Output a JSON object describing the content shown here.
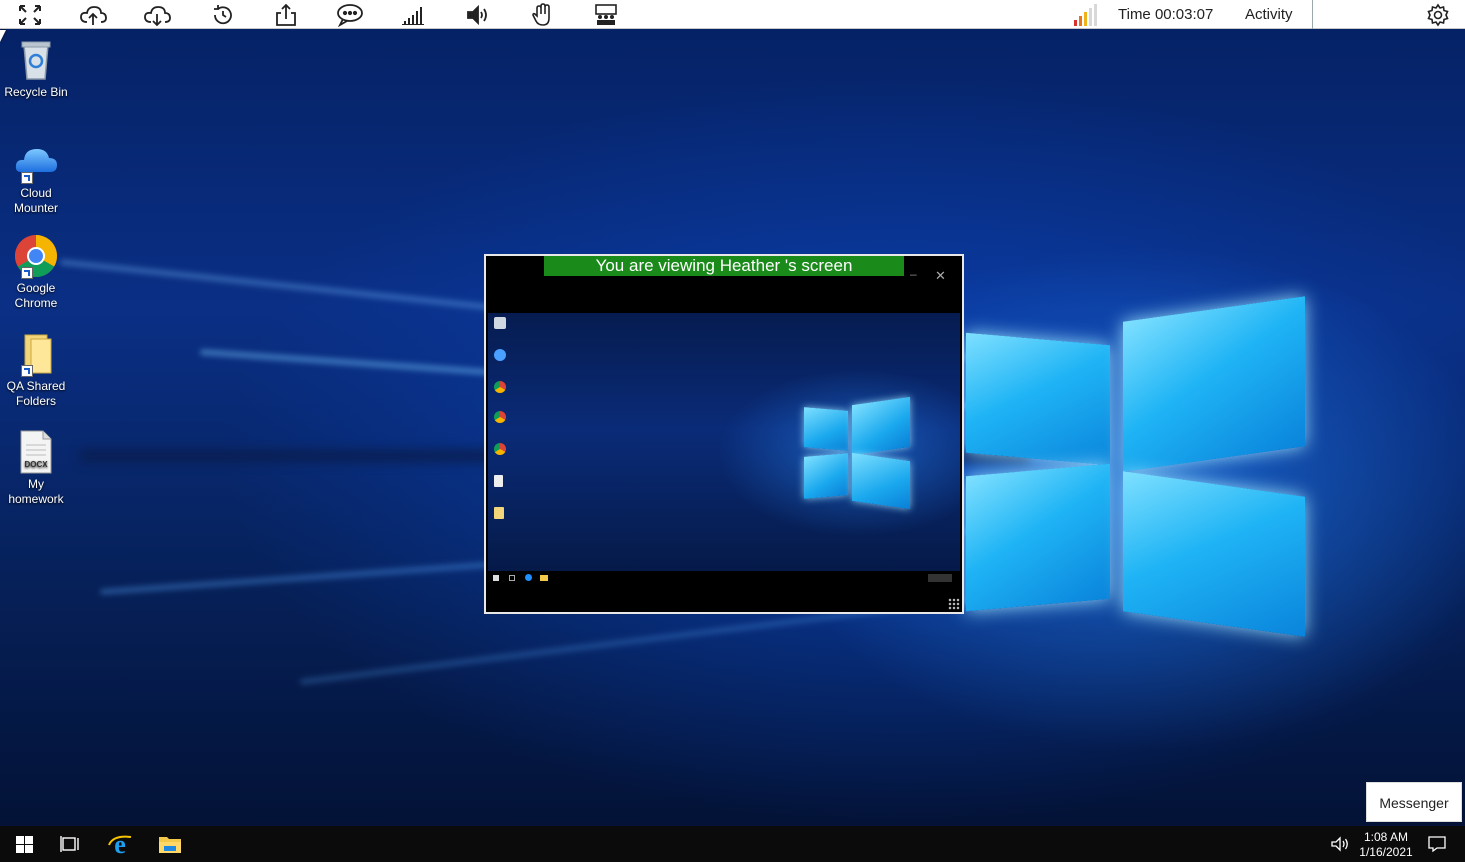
{
  "toolbar": {
    "icons": [
      {
        "name": "fullscreen-icon"
      },
      {
        "name": "cloud-upload-icon"
      },
      {
        "name": "cloud-download-icon"
      },
      {
        "name": "history-icon"
      },
      {
        "name": "share-icon"
      },
      {
        "name": "chat-icon"
      },
      {
        "name": "signal-bars-icon"
      },
      {
        "name": "volume-icon"
      },
      {
        "name": "raise-hand-icon"
      },
      {
        "name": "presenter-icon"
      }
    ],
    "time_label": "Time 00:03:07",
    "activity_label": "Activity",
    "settings_icon": "gear-icon"
  },
  "desktop_icons": [
    {
      "label": "Recycle Bin"
    },
    {
      "label": "Cloud Mounter"
    },
    {
      "label": "Google Chrome"
    },
    {
      "label": "QA Shared Folders"
    },
    {
      "label": "My homework",
      "badge": "DOCX"
    }
  ],
  "viewer": {
    "banner": "You are viewing Heather 's screen",
    "minimize_glyph": "–",
    "close_glyph": "✕"
  },
  "messenger": {
    "label": "Messenger"
  },
  "taskbar": {
    "clock_time": "1:08 AM",
    "clock_date": "1/16/2021"
  },
  "colors": {
    "banner_green": "#1a8a1a",
    "taskbar": "#0b0b0b",
    "toolbar": "#ffffff"
  }
}
